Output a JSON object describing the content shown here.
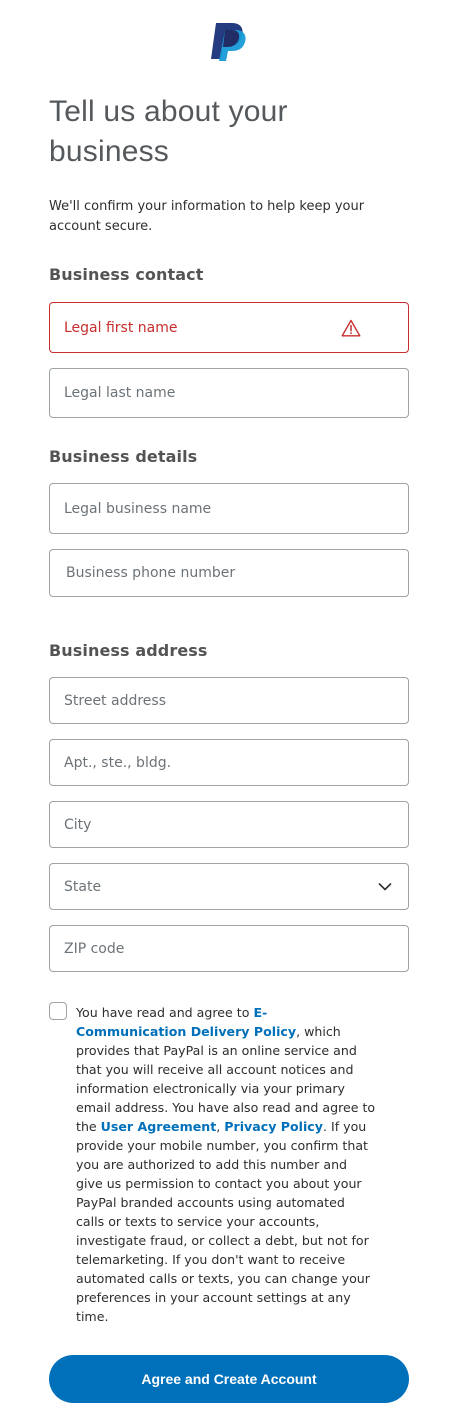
{
  "brand": {
    "logo_icon": "paypal-logo-icon",
    "primary_color": "#0070ba",
    "error_color": "#c72e2e"
  },
  "header": {
    "title": "Tell us about your business",
    "intro": "We'll confirm your information to help keep your account secure."
  },
  "business_contact": {
    "heading": "Business contact",
    "first_name": {
      "placeholder": "Legal first name",
      "state": "error",
      "icon": "warning-icon"
    },
    "last_name": {
      "placeholder": "Legal last name"
    }
  },
  "business_details": {
    "heading": "Business details",
    "business_name": {
      "placeholder": "Legal business name"
    },
    "phone": {
      "placeholder": "Business phone number"
    }
  },
  "business_address": {
    "heading": "Business address",
    "street": {
      "placeholder": "Street address"
    },
    "apt": {
      "placeholder": "Apt., ste., bldg."
    },
    "city": {
      "placeholder": "City"
    },
    "state": {
      "placeholder": "State",
      "icon": "chevron-down-icon"
    },
    "zip": {
      "placeholder": "ZIP code"
    }
  },
  "consent": {
    "checked": false,
    "text_1": "You have read and agree to ",
    "link_ecomm": "E-Communication Delivery Policy",
    "text_2": ", which provides that PayPal is an online service and that you will receive all account notices and information electronically via your primary email address. You have also read and agree to the ",
    "link_user_agreement": "User Agreement",
    "text_3": ", ",
    "link_privacy": "Privacy Policy",
    "text_4": ". If you provide your mobile number, you confirm that you are authorized to add this number and give us permission to contact you about your PayPal branded accounts using automated calls or texts to service your accounts, investigate fraud, or collect a debt, but not for telemarketing. If you don't want to receive automated calls or texts, you can change your preferences in your account settings at any time."
  },
  "submit": {
    "label": "Agree and Create Account"
  }
}
